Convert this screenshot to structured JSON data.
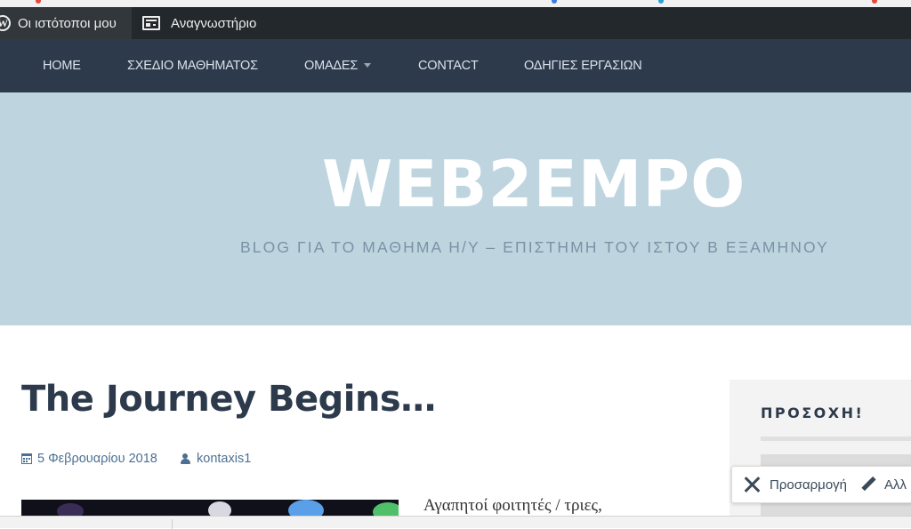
{
  "admin_bar": {
    "my_sites_label": "Οι ιστότοποι μου",
    "reader_label": "Αναγνωστήριο"
  },
  "nav": {
    "items": [
      {
        "label": "HOME"
      },
      {
        "label": "ΣΧΕΔΙΟ ΜΑΘΗΜΑΤΟΣ"
      },
      {
        "label": "ΟΜΑΔΕΣ",
        "has_dropdown": true
      },
      {
        "label": "CONTACT"
      },
      {
        "label": "ΟΔΗΓΙΕΣ ΕΡΓΑΣΙΩΝ"
      }
    ]
  },
  "header": {
    "site_title": "WEB2EMPO",
    "tagline": "BLOG ΓΙΑ ΤΟ ΜΑΘΗΜΑ Η/Υ – ΕΠΙΣΤΗΜΗ ΤΟΥ ΙΣΤΟΥ Β ΕΞΑΜΗΝΟΥ"
  },
  "post": {
    "title": "The Journey Begins…",
    "date": "5 Φεβρουαρίου 2018",
    "author": "kontaxis1",
    "excerpt": "Αγαπητοί φοιτητές / τριες,"
  },
  "sidebar": {
    "widget_title": "ΠΡΟΣΟΧΗ!"
  },
  "customize_bar": {
    "customize_label": "Προσαρμογή",
    "edit_label": "Αλλ"
  },
  "colors": {
    "admin_bar_bg": "#23282d",
    "nav_bg": "#2c3a4b",
    "banner_bg": "#bed5e0",
    "meta_link": "#4b7093"
  },
  "icons": [
    "wordpress-icon",
    "reader-icon",
    "chevron-down-icon",
    "calendar-icon",
    "user-icon",
    "tools-icon",
    "pencil-icon"
  ]
}
